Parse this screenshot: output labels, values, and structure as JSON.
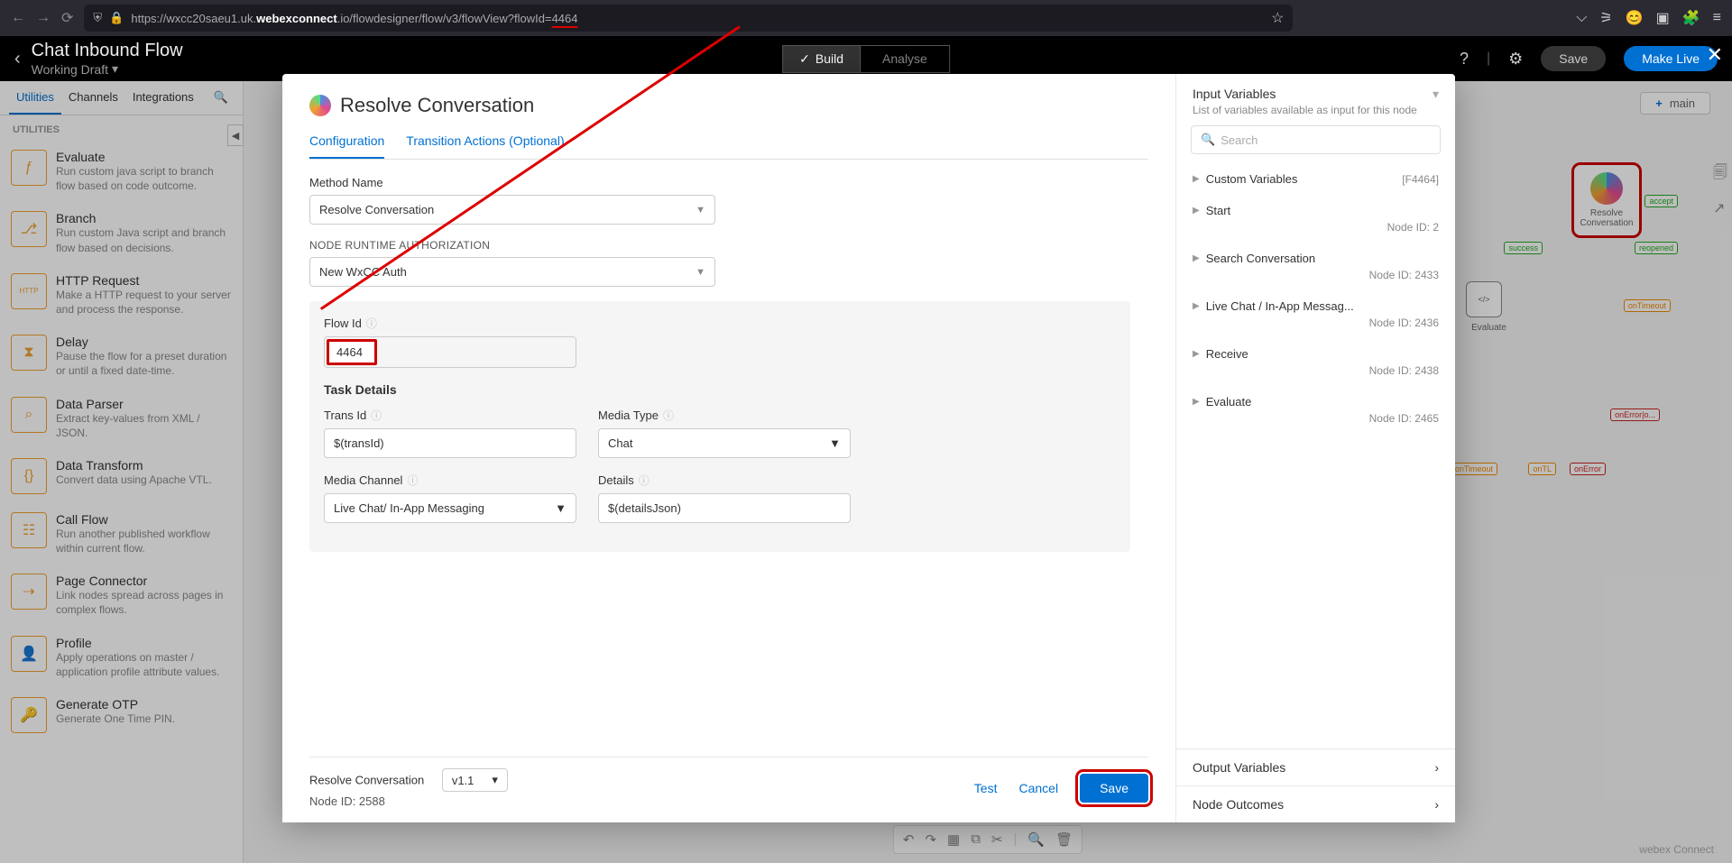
{
  "browser": {
    "url_prefix": "https://wxcc20saeu1.uk.",
    "url_bold": "webexconnect",
    "url_suffix": ".io/flowdesigner/flow/v3/flowView?flowId=",
    "url_id": "4464"
  },
  "header": {
    "title": "Chat Inbound Flow",
    "subtitle": "Working Draft",
    "tab_build": "Build",
    "tab_analyse": "Analyse",
    "save": "Save",
    "make_live": "Make Live"
  },
  "sidebar": {
    "tabs": [
      "Utilities",
      "Channels",
      "Integrations"
    ],
    "section": "UTILITIES",
    "items": [
      {
        "title": "Evaluate",
        "desc": "Run custom java script to branch flow based on code outcome.",
        "glyph": "ƒ"
      },
      {
        "title": "Branch",
        "desc": "Run custom Java script and branch flow based on decisions.",
        "glyph": "⎇"
      },
      {
        "title": "HTTP Request",
        "desc": "Make a HTTP request to your server and process the response.",
        "glyph": "HTTP"
      },
      {
        "title": "Delay",
        "desc": "Pause the flow for a preset duration or until a fixed date-time.",
        "glyph": "⧗"
      },
      {
        "title": "Data Parser",
        "desc": "Extract key-values from XML / JSON.",
        "glyph": "⌕"
      },
      {
        "title": "Data Transform",
        "desc": "Convert data using Apache VTL.",
        "glyph": "{}"
      },
      {
        "title": "Call Flow",
        "desc": "Run another published workflow within current flow.",
        "glyph": "☷"
      },
      {
        "title": "Page Connector",
        "desc": "Link nodes spread across pages in complex flows.",
        "glyph": "⇢"
      },
      {
        "title": "Profile",
        "desc": "Apply operations on master / application profile attribute values.",
        "glyph": "👤"
      },
      {
        "title": "Generate OTP",
        "desc": "Generate One Time PIN.",
        "glyph": "🔑"
      }
    ]
  },
  "canvas": {
    "main_label": "main",
    "resolve_label": "Resolve Conversation",
    "tags": {
      "success": "success",
      "evaluate": "Evaluate",
      "accept": "accept",
      "reopened": "reopened",
      "onTimeout": "onTimeout",
      "onError": "onError",
      "onTL1": "onTL",
      "onErroric": "onError|o..."
    },
    "footer_brand": "webex Connect"
  },
  "modal": {
    "title": "Resolve Conversation",
    "tab_config": "Configuration",
    "tab_trans": "Transition Actions (Optional)",
    "method_label": "Method Name",
    "method_value": "Resolve Conversation",
    "auth_label": "NODE RUNTIME AUTHORIZATION",
    "auth_value": "New WxCC Auth",
    "flowid_label": "Flow Id",
    "flowid_value": "4464",
    "taskdetails": "Task Details",
    "transid_label": "Trans Id",
    "transid_value": "$(transId)",
    "mediatype_label": "Media Type",
    "mediatype_value": "Chat",
    "mediachannel_label": "Media Channel",
    "mediachannel_value": "Live Chat/ In-App Messaging",
    "details_label": "Details",
    "details_value": "$(detailsJson)",
    "footer_name": "Resolve Conversation",
    "footer_nodeid": "Node ID: 2588",
    "footer_version": "v1.1",
    "btn_test": "Test",
    "btn_cancel": "Cancel",
    "btn_save": "Save"
  },
  "right": {
    "title": "Input Variables",
    "subtitle": "List of variables available as input for this node",
    "search_ph": "Search",
    "items": [
      {
        "name": "Custom Variables",
        "meta": "[F4464]"
      },
      {
        "name": "Start",
        "sub": "Node ID: 2"
      },
      {
        "name": "Search Conversation",
        "sub": "Node ID: 2433"
      },
      {
        "name": "Live Chat / In-App Messag...",
        "sub": "Node ID: 2436"
      },
      {
        "name": "Receive",
        "sub": "Node ID: 2438"
      },
      {
        "name": "Evaluate",
        "sub": "Node ID: 2465"
      }
    ],
    "output": "Output Variables",
    "outcomes": "Node Outcomes"
  }
}
